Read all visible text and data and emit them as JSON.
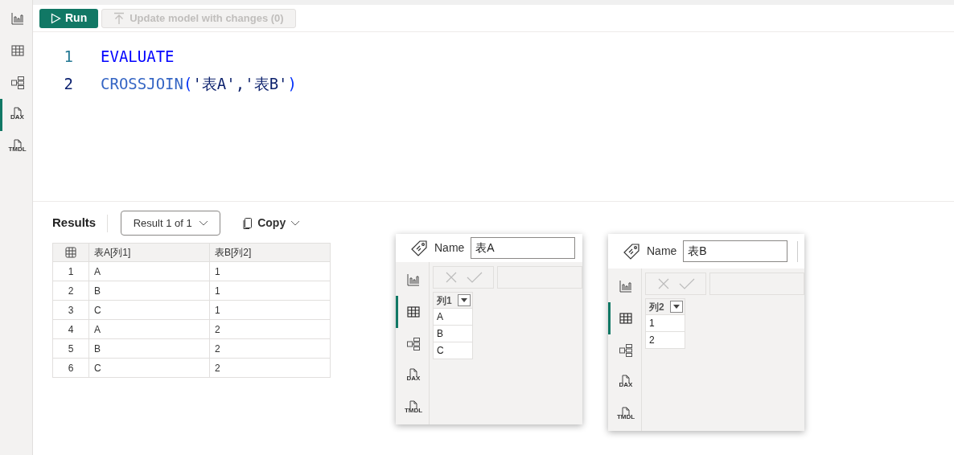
{
  "sidebar": {
    "items": [
      {
        "kind": "report",
        "selected": false
      },
      {
        "kind": "table",
        "selected": false
      },
      {
        "kind": "model",
        "selected": false
      },
      {
        "kind": "dax",
        "label": "DAX",
        "selected": true
      },
      {
        "kind": "tmdl",
        "label": "TMDL",
        "selected": false
      }
    ]
  },
  "toolbar": {
    "run": "Run",
    "update": {
      "label": "Update model with changes (0)",
      "disabled": true
    }
  },
  "editor": {
    "lines": [
      {
        "number": "1",
        "active": false,
        "tokens": [
          {
            "kind": "keyword",
            "text": "EVALUATE"
          }
        ]
      },
      {
        "number": "2",
        "active": true,
        "tokens": [
          {
            "kind": "function",
            "text": "CROSSJOIN"
          },
          {
            "kind": "paren",
            "text": "("
          },
          {
            "kind": "string",
            "text": "'表A'"
          },
          {
            "kind": "punct",
            "text": ","
          },
          {
            "kind": "string",
            "text": "'表B'"
          },
          {
            "kind": "paren",
            "text": ")"
          }
        ]
      }
    ]
  },
  "results": {
    "title": "Results",
    "result_picker": "Result 1 of 1",
    "copy": "Copy",
    "table": {
      "columns": [
        "表A[列1]",
        "表B[列2]"
      ],
      "rows": [
        {
          "index": "1",
          "cells": [
            "A",
            "1"
          ]
        },
        {
          "index": "2",
          "cells": [
            "B",
            "1"
          ]
        },
        {
          "index": "3",
          "cells": [
            "C",
            "1"
          ]
        },
        {
          "index": "4",
          "cells": [
            "A",
            "2"
          ]
        },
        {
          "index": "5",
          "cells": [
            "B",
            "2"
          ]
        },
        {
          "index": "6",
          "cells": [
            "C",
            "2"
          ]
        }
      ]
    }
  },
  "table_views": [
    {
      "name_label": "Name",
      "name_value": "表A",
      "divider": false,
      "sidebar": [
        {
          "kind": "report",
          "selected": false
        },
        {
          "kind": "table",
          "selected": true
        },
        {
          "kind": "model",
          "selected": false
        },
        {
          "kind": "dax",
          "label": "DAX",
          "selected": false
        },
        {
          "kind": "tmdl",
          "label": "TMDL",
          "selected": false
        }
      ],
      "column": "列1",
      "values": [
        "A",
        "B",
        "C"
      ]
    },
    {
      "name_label": "Name",
      "name_value": "表B",
      "divider": true,
      "sidebar": [
        {
          "kind": "report",
          "selected": false
        },
        {
          "kind": "table",
          "selected": true
        },
        {
          "kind": "model",
          "selected": false
        },
        {
          "kind": "dax",
          "label": "DAX",
          "selected": false
        },
        {
          "kind": "tmdl",
          "label": "TMDL",
          "selected": false
        }
      ],
      "column": "列2",
      "values": [
        "1",
        "2"
      ]
    }
  ]
}
